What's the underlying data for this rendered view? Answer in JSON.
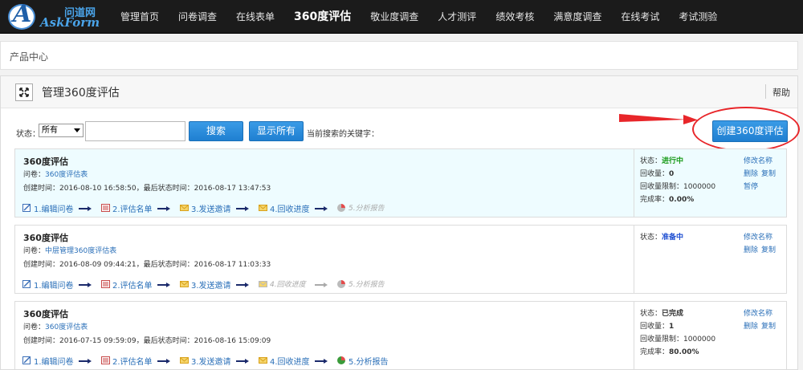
{
  "brand": {
    "cn": "问道网",
    "en": "AskForm"
  },
  "nav": [
    {
      "label": "管理首页",
      "active": false
    },
    {
      "label": "问卷调查",
      "active": false
    },
    {
      "label": "在线表单",
      "active": false
    },
    {
      "label": "360度评估",
      "active": true
    },
    {
      "label": "敬业度调查",
      "active": false
    },
    {
      "label": "人才测评",
      "active": false
    },
    {
      "label": "绩效考核",
      "active": false
    },
    {
      "label": "满意度调查",
      "active": false
    },
    {
      "label": "在线考试",
      "active": false
    },
    {
      "label": "考试测验",
      "active": false
    }
  ],
  "breadcrumb": "产品中心",
  "panel": {
    "title": "管理360度评估",
    "help": "帮助"
  },
  "filter": {
    "status_label": "状态：",
    "status_value": "所有",
    "search_value": "",
    "search_button": "搜索",
    "show_all_button": "显示所有",
    "keyword_label": "当前搜索的关键字："
  },
  "create_button": "创建360度评估",
  "records": [
    {
      "title": "360度评估",
      "questionnaire_label": "问卷：",
      "questionnaire": "360度评估表",
      "created_label": "创建时间：",
      "created": "2016-08-10 16:58:50",
      "last_label": "，最后状态时间：",
      "last": "2016-08-17 13:47:53",
      "steps": [
        {
          "label": "1.编辑问卷",
          "enabled": true
        },
        {
          "label": "2.评估名单",
          "enabled": true
        },
        {
          "label": "3.发送邀请",
          "enabled": true
        },
        {
          "label": "4.回收进度",
          "enabled": true
        },
        {
          "label": "5.分析报告",
          "enabled": false
        }
      ],
      "status_label": "状态：",
      "status": "进行中",
      "recovered_label": "回收量：",
      "recovered": "0",
      "limit_label": "回收量限制：",
      "limit": "1000000",
      "rate_label": "完成率：",
      "rate": "0.00%",
      "actions": [
        "修改名称",
        "删除",
        "复制",
        "暂停"
      ]
    },
    {
      "title": "360度评估",
      "questionnaire_label": "问卷：",
      "questionnaire": "中层管理360度评估表",
      "created_label": "创建时间：",
      "created": "2016-08-09 09:44:21",
      "last_label": "，最后状态时间：",
      "last": "2016-08-17 11:03:33",
      "steps": [
        {
          "label": "1.编辑问卷",
          "enabled": true
        },
        {
          "label": "2.评估名单",
          "enabled": true
        },
        {
          "label": "3.发送邀请",
          "enabled": true
        },
        {
          "label": "4.回收进度",
          "enabled": false
        },
        {
          "label": "5.分析报告",
          "enabled": false
        }
      ],
      "status_label": "状态：",
      "status": "准备中",
      "actions": [
        "修改名称",
        "删除",
        "复制"
      ]
    },
    {
      "title": "360度评估",
      "questionnaire_label": "问卷：",
      "questionnaire": "360度评估表",
      "created_label": "创建时间：",
      "created": "2016-07-15 09:59:09",
      "last_label": "，最后状态时间：",
      "last": "2016-08-16 15:09:09",
      "steps": [
        {
          "label": "1.编辑问卷",
          "enabled": true
        },
        {
          "label": "2.评估名单",
          "enabled": true
        },
        {
          "label": "3.发送邀请",
          "enabled": true
        },
        {
          "label": "4.回收进度",
          "enabled": true
        },
        {
          "label": "5.分析报告",
          "enabled": true
        }
      ],
      "status_label": "状态：",
      "status": "已完成",
      "recovered_label": "回收量：",
      "recovered": "1",
      "limit_label": "回收量限制：",
      "limit": "1000000",
      "rate_label": "完成率：",
      "rate": "80.00%",
      "actions": [
        "修改名称",
        "删除",
        "复制"
      ]
    }
  ],
  "colors": {
    "nav_bg": "#1b1b1b",
    "accent": "#1f7fd1",
    "link": "#2a6fb8",
    "status_running": "#1a9b1a",
    "status_preparing": "#1f4fd1",
    "annotation": "#e8262a"
  },
  "icons": [
    "expand-icon",
    "edit-icon",
    "list-icon",
    "mail-icon",
    "chart-icon",
    "arrow-right-icon"
  ]
}
